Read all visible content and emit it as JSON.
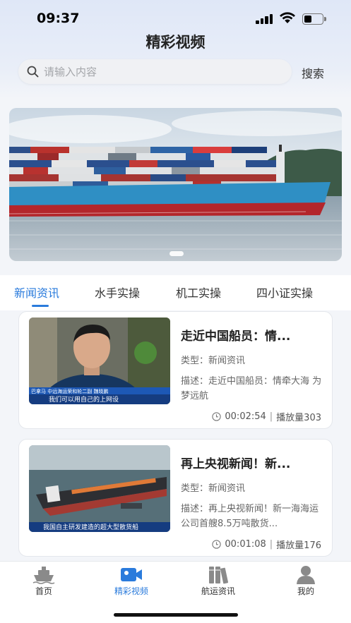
{
  "status_bar": {
    "time": "09:37"
  },
  "header": {
    "title": "精彩视频"
  },
  "search": {
    "placeholder": "请输入内容",
    "button_label": "搜索"
  },
  "banner": {
    "slide_count": 1,
    "active_slide": 1
  },
  "tabs": [
    {
      "label": "新闻资讯",
      "active": true
    },
    {
      "label": "水手实操",
      "active": false
    },
    {
      "label": "机工实操",
      "active": false
    },
    {
      "label": "四小证实操",
      "active": false
    }
  ],
  "videos": [
    {
      "title": "走近中国船员：情...",
      "type": "类型：新闻资讯",
      "description": "描述：走近中国船员：情牵大海 为梦远航",
      "duration": "00:02:54",
      "plays": "播放量303",
      "thumb_caption_top": "巴拿马  中远海运荣和轮二副 魏晓鹏",
      "thumb_caption_bottom": "我们可以用自己的上网设"
    },
    {
      "title": "再上央视新闻！新...",
      "type": "类型：新闻资讯",
      "description": "描述：再上央视新闻！新一海海运公司首艘8.5万吨散货...",
      "duration": "00:01:08",
      "plays": "播放量176",
      "thumb_caption_bottom": "我国自主研发建造的超大型散货船"
    }
  ],
  "bottom_nav": [
    {
      "label": "首页",
      "icon": "ship-icon",
      "active": false
    },
    {
      "label": "精彩视频",
      "icon": "video-camera-icon",
      "active": true
    },
    {
      "label": "航运资讯",
      "icon": "books-icon",
      "active": false
    },
    {
      "label": "我的",
      "icon": "user-icon",
      "active": false
    }
  ],
  "colors": {
    "accent": "#2a7bdc",
    "background": "#f3f5f9"
  }
}
